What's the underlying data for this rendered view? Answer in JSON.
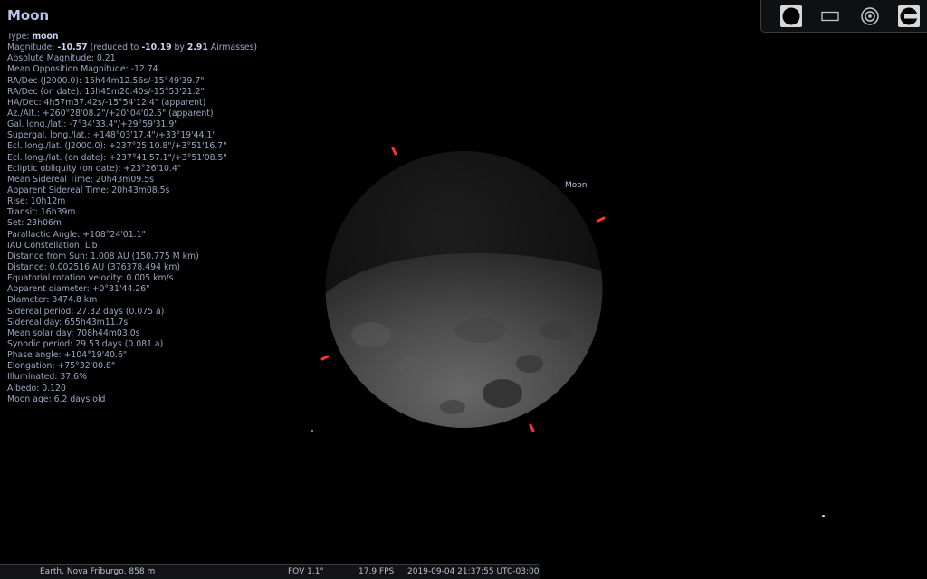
{
  "object": {
    "name": "Moon",
    "label": "Moon",
    "info_lines": [
      {
        "label": "Type: ",
        "bold": "moon"
      },
      {
        "label": "Magnitude: ",
        "bold": "-10.57",
        "rest1": " (reduced to ",
        "bold2": "-10.19",
        "rest2": " by ",
        "bold3": "2.91",
        "rest3": " Airmasses)"
      },
      {
        "text": "Absolute Magnitude: 0.21"
      },
      {
        "text": "Mean Opposition Magnitude: -12.74"
      },
      {
        "text": "RA/Dec (J2000.0): 15h44m12.56s/-15°49'39.7\""
      },
      {
        "text": "RA/Dec (on date): 15h45m20.40s/-15°53'21.2\""
      },
      {
        "text": "HA/Dec: 4h57m37.42s/-15°54'12.4\" (apparent)"
      },
      {
        "text": "Az./Alt.: +260°28'08.2\"/+20°04'02.5\" (apparent)"
      },
      {
        "text": "Gal. long./lat.: -7°34'33.4\"/+29°59'31.9\""
      },
      {
        "text": "Supergal. long./lat.: +148°03'17.4\"/+33°19'44.1\""
      },
      {
        "text": "Ecl. long./lat. (J2000.0): +237°25'10.8\"/+3°51'16.7\""
      },
      {
        "text": "Ecl. long./lat. (on date): +237°41'57.1\"/+3°51'08.5\""
      },
      {
        "text": "Ecliptic obliquity (on date): +23°26'10.4\""
      },
      {
        "text": "Mean Sidereal Time: 20h43m09.5s"
      },
      {
        "text": "Apparent Sidereal Time: 20h43m08.5s"
      },
      {
        "text": "Rise: 10h12m"
      },
      {
        "text": "Transit: 16h39m"
      },
      {
        "text": "Set: 23h06m"
      },
      {
        "text": "Parallactic Angle: +108°24'01.1\""
      },
      {
        "text": "IAU Constellation: Lib"
      },
      {
        "text": "Distance from Sun: 1.008 AU (150.775 M km)"
      },
      {
        "text": "Distance: 0.002516 AU (376378.494 km)"
      },
      {
        "text": "Equatorial rotation velocity: 0.005 km/s"
      },
      {
        "text": "Apparent diameter: +0°31'44.26\""
      },
      {
        "text": "Diameter: 3474.8 km"
      },
      {
        "text": "Sidereal period: 27.32 days (0.075 a)"
      },
      {
        "text": "Sidereal day: 655h43m11.7s"
      },
      {
        "text": "Mean solar day: 708h44m03.0s"
      },
      {
        "text": "Synodic period: 29.53 days (0.081 a)"
      },
      {
        "text": "Phase angle: +104°19'40.6\""
      },
      {
        "text": "Elongation: +75°32'00.8\""
      },
      {
        "text": "Illuminated: 37.6%"
      },
      {
        "text": "Albedo: 0.120"
      },
      {
        "text": "Moon age: 6.2 days old"
      }
    ]
  },
  "toolbar": {
    "buttons": [
      {
        "name": "moon-view-button",
        "icon": "filled-circle-icon"
      },
      {
        "name": "screen-frame-button",
        "icon": "rectangle-outline-icon"
      },
      {
        "name": "center-target-button",
        "icon": "concentric-circles-icon"
      },
      {
        "name": "telescope-button",
        "icon": "telescope-eyepiece-icon"
      }
    ]
  },
  "status": {
    "location": "Earth, Nova Friburgo, 858 m",
    "fov": "FOV 1.1°",
    "fps": "17.9 FPS",
    "datetime": "2019-09-04 21:37:55 UTC-03:00"
  },
  "colors": {
    "background": "#000000",
    "info_text": "#9aa6c4",
    "title": "#b8c4e6",
    "marker": "#ff3030"
  }
}
